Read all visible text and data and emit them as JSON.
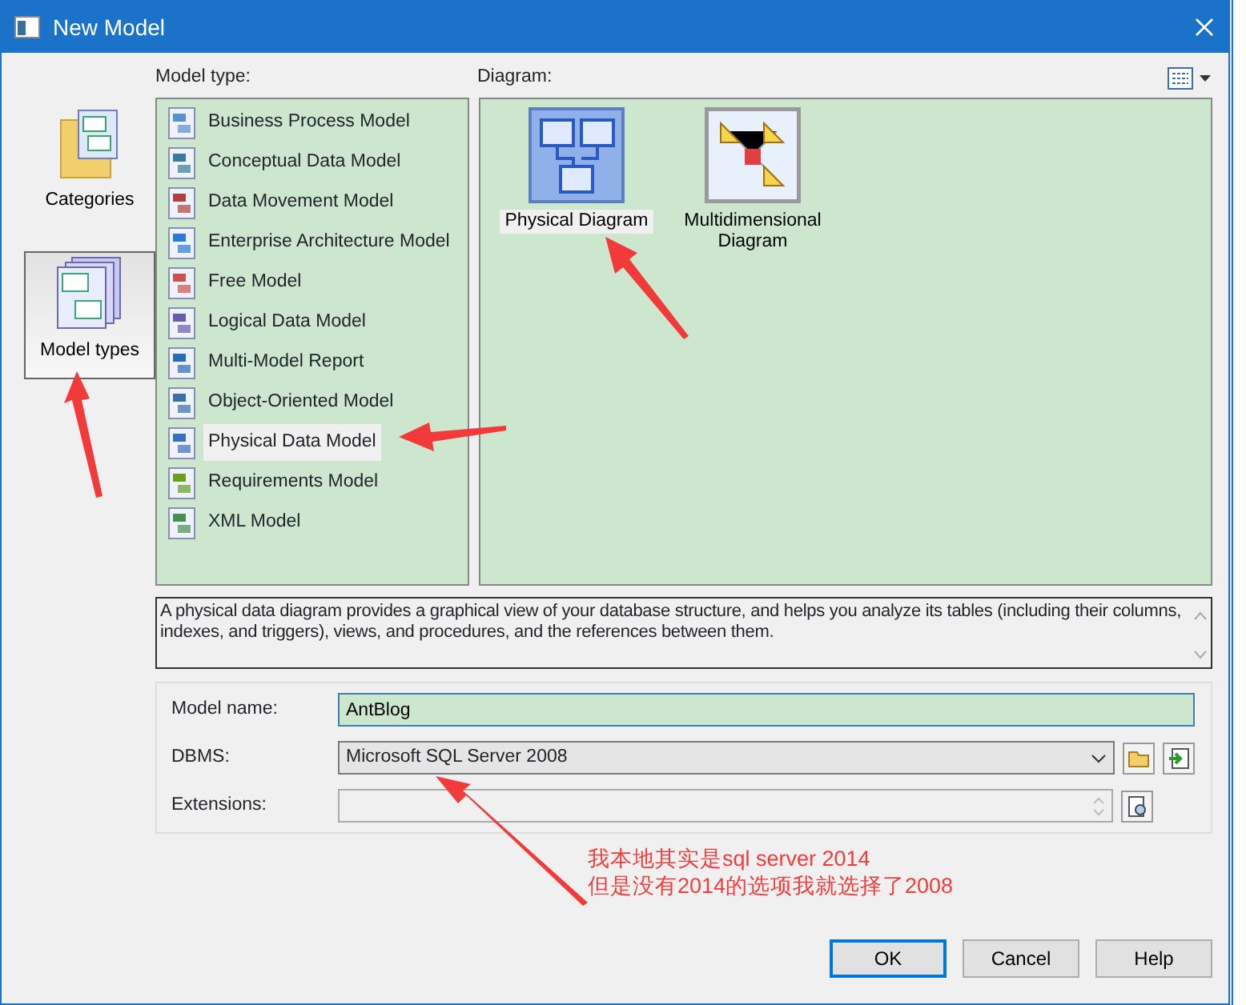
{
  "window": {
    "title": "New Model"
  },
  "sidebar": {
    "items": [
      {
        "label": "Categories",
        "selected": false
      },
      {
        "label": "Model types",
        "selected": true
      }
    ]
  },
  "model_type": {
    "label": "Model type:",
    "items": [
      {
        "label": "Business Process Model",
        "selected": false
      },
      {
        "label": "Conceptual Data Model",
        "selected": false
      },
      {
        "label": "Data Movement Model",
        "selected": false
      },
      {
        "label": "Enterprise Architecture Model",
        "selected": false
      },
      {
        "label": "Free Model",
        "selected": false
      },
      {
        "label": "Logical Data Model",
        "selected": false
      },
      {
        "label": "Multi-Model Report",
        "selected": false
      },
      {
        "label": "Object-Oriented Model",
        "selected": false
      },
      {
        "label": "Physical Data Model",
        "selected": true
      },
      {
        "label": "Requirements Model",
        "selected": false
      },
      {
        "label": "XML Model",
        "selected": false
      }
    ]
  },
  "diagram": {
    "label": "Diagram:",
    "items": [
      {
        "label": "Physical Diagram",
        "selected": true
      },
      {
        "label": "Multidimensional Diagram",
        "selected": false
      }
    ]
  },
  "description": "A physical data diagram provides a graphical view of your database structure, and helps you analyze its tables (including their columns, indexes, and triggers), views, and procedures, and the references between them.",
  "fields": [
    {
      "kind": "text",
      "label": "Model name:",
      "value": "AntBlog"
    },
    {
      "kind": "select",
      "label": "DBMS:",
      "value": "Microsoft SQL Server 2008"
    },
    {
      "kind": "spin",
      "label": "Extensions:"
    }
  ],
  "annotation": {
    "lines": [
      "我本地其实是sql server 2014",
      "但是没有2014的选项我就选择了2008"
    ]
  },
  "buttons": [
    {
      "label": "OK",
      "default": true
    },
    {
      "label": "Cancel",
      "default": false
    },
    {
      "label": "Help",
      "default": false
    }
  ]
}
